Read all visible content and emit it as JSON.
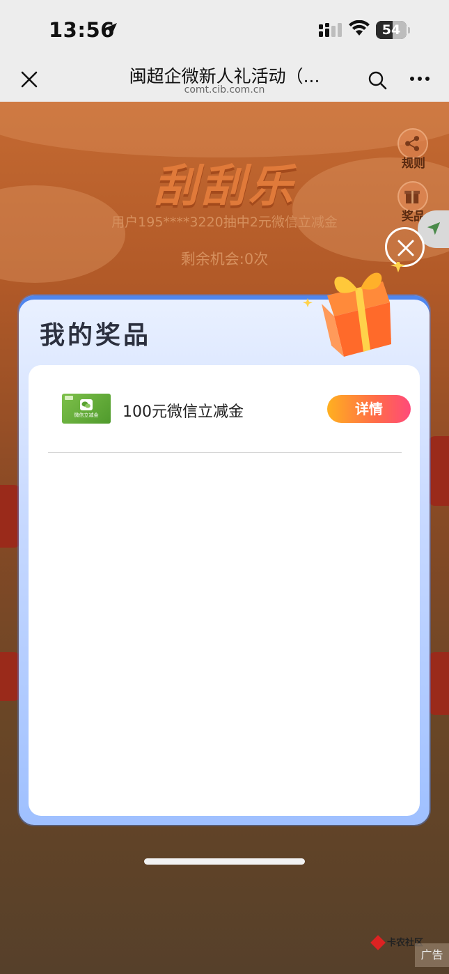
{
  "status_bar": {
    "time": "13:56",
    "battery_level": "54",
    "battery_percent": 54
  },
  "nav": {
    "title": "闽超企微新人礼活动（...",
    "url": "comt.cib.com.cn"
  },
  "background": {
    "game_title": "刮刮乐",
    "winner_text": "用户195****3220抽中2元微信立减金",
    "chances_text": "剩余机会:0次",
    "rules_label": "规则",
    "prizes_label": "奖品",
    "watermark_text": "卡农社区",
    "ad_label": "广告"
  },
  "modal": {
    "title": "我的奖品",
    "prizes": [
      {
        "name": "100元微信立减金",
        "coupon_text": "微信立减金",
        "button": "详情"
      }
    ]
  },
  "colors": {
    "accent_gradient_start": "#ffb020",
    "accent_gradient_end": "#ff4a7a",
    "modal_blue": "#4f86ee",
    "coupon_green": "#5aa232"
  }
}
